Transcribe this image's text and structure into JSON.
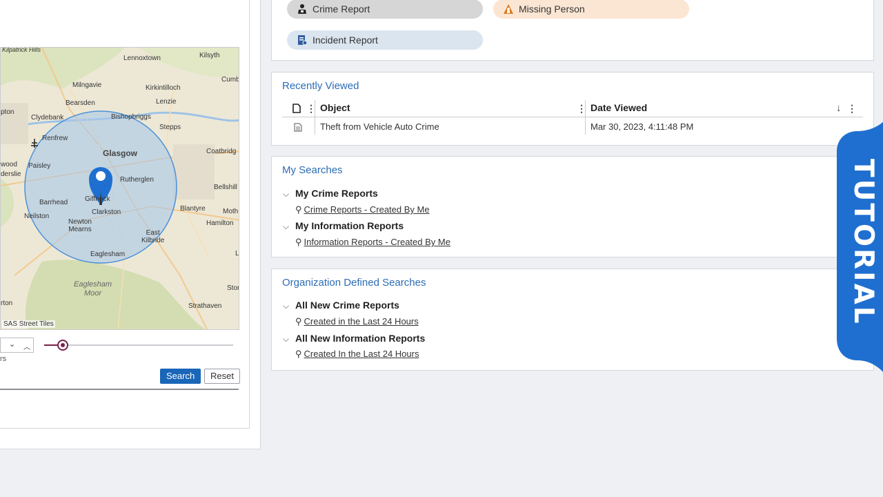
{
  "map": {
    "attribution": "SAS Street Tiles",
    "labels": {
      "kilpatrick": "Kilpatrick\nHills",
      "lennoxtown": "Lennoxtown",
      "kilsyth": "Kilsyth",
      "milngavie": "Milngavie",
      "kirkintilloch": "Kirkintilloch",
      "cumb": "Cumb",
      "bearsden": "Bearsden",
      "lenzie": "Lenzie",
      "clydebank": "Clydebank",
      "bishopbriggs": "Bishopbriggs",
      "stepps": "Stepps",
      "pton": "pton",
      "renfrew": "Renfrew",
      "glasgow": "Glasgow",
      "coatbridge": "Coatbridg",
      "wood": "wood",
      "paisley": "Paisley",
      "erslie": "derslie",
      "rutherglen": "Rutherglen",
      "bellshill": "Bellshill",
      "barrhead": "Barrhead",
      "giffnock": "Giffnock",
      "blantyre": "Blantyre",
      "moth": "Moth",
      "neilston": "Neilston",
      "clarkston": "Clarkston",
      "newton_mearns": "Newton\nMearns",
      "hamilton": "Hamilton",
      "east_kilbride": "East\nKilbride",
      "eaglesham": "Eaglesham",
      "eaglesham_moor": "Eaglesham\nMoor",
      "stor": "Stor",
      "rton": "rton",
      "strathaven": "Strathaven",
      "l": "L"
    }
  },
  "search_panel": {
    "units_fragment": "rs",
    "slider_value_fraction": 0.1,
    "search_label": "Search",
    "reset_label": "Reset"
  },
  "quick_create": [
    {
      "label": "Crime Report",
      "icon": "crime-report-icon",
      "color": "#d6d6d6"
    },
    {
      "label": "Missing Person",
      "icon": "missing-person-icon",
      "color": "#fbe6d3"
    },
    {
      "label": "Incident Report",
      "icon": "incident-report-icon",
      "color": "#dbe5ef"
    }
  ],
  "recently_viewed": {
    "title": "Recently Viewed",
    "columns": {
      "object": "Object",
      "date": "Date Viewed"
    },
    "rows": [
      {
        "object": "Theft from Vehicle Auto Crime",
        "date": "Mar 30, 2023, 4:11:48 PM"
      }
    ]
  },
  "my_searches": {
    "title": "My Searches",
    "groups": [
      {
        "name": "My Crime Reports",
        "link": "Crime Reports - Created By Me"
      },
      {
        "name": "My Information Reports",
        "link": "Information Reports - Created By Me"
      }
    ]
  },
  "org_searches": {
    "title": "Organization Defined Searches",
    "groups": [
      {
        "name": "All New Crime Reports",
        "link": "Created in the Last 24 Hours"
      },
      {
        "name": "All New Information Reports",
        "link": "Created In the Last 24 Hours"
      }
    ]
  },
  "overlay": {
    "text": "TUTORIAL",
    "color": "#1f6fd0"
  },
  "colors": {
    "accent": "#2b6cb5",
    "button": "#1a66b8",
    "slider": "#7a1f4a"
  }
}
